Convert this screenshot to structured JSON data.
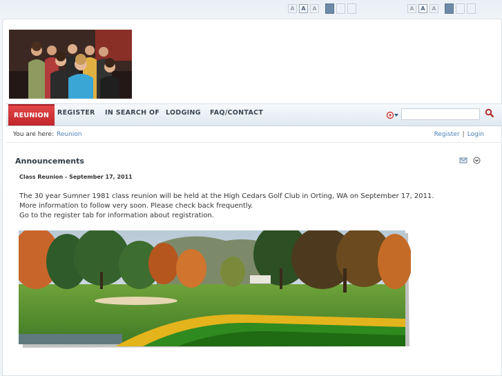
{
  "font_controls": {
    "small": "A",
    "medium": "A",
    "large": "A"
  },
  "nav": {
    "items": [
      {
        "label": "REUNION"
      },
      {
        "label": "REGISTER"
      },
      {
        "label": "IN SEARCH OF"
      },
      {
        "label": "LODGING"
      },
      {
        "label": "FAQ/CONTACT"
      }
    ],
    "active_index": 0
  },
  "breadcrumb": {
    "label": "You are here:",
    "current": "Reunion"
  },
  "user_links": {
    "register": "Register",
    "separator": "|",
    "login": "Login"
  },
  "section": {
    "heading": "Announcements",
    "article_title": "Class Reunion - September 17, 2011",
    "paragraphs": [
      "The 30 year Sumner 1981 class reunion will be held at the High Cedars Golf Club in Orting, WA on September 17, 2011.",
      "More information to follow very soon. Please check back frequently.",
      "Go to the register tab for information about registration."
    ]
  },
  "colors": {
    "accent": "#c8282c",
    "link": "#4a7fb0"
  },
  "icons": {
    "search": "magnifier-icon",
    "language": "flag-icon",
    "email": "email-icon",
    "collapse": "collapse-icon"
  }
}
